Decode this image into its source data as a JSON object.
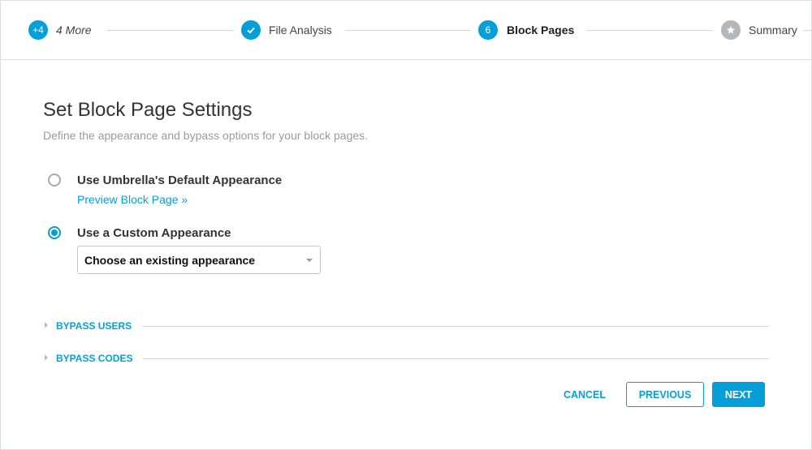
{
  "wizard": {
    "steps": [
      {
        "badge": "+4",
        "label": "4 More"
      },
      {
        "badge": "check",
        "label": "File Analysis"
      },
      {
        "badge": "6",
        "label": "Block Pages"
      },
      {
        "badge": "star",
        "label": "Summary"
      }
    ]
  },
  "main": {
    "title": "Set Block Page Settings",
    "subtitle": "Define the appearance and bypass options for your block pages.",
    "option_default": "Use Umbrella's Default Appearance",
    "preview_link": "Preview Block Page »",
    "option_custom": "Use a Custom Appearance",
    "appearance_select": "Choose an existing appearance",
    "bypass_users": "BYPASS USERS",
    "bypass_codes": "BYPASS CODES"
  },
  "footer": {
    "cancel": "CANCEL",
    "previous": "PREVIOUS",
    "next": "NEXT"
  },
  "colors": {
    "accent": "#049fd9",
    "inactive": "#b6b7bb"
  }
}
